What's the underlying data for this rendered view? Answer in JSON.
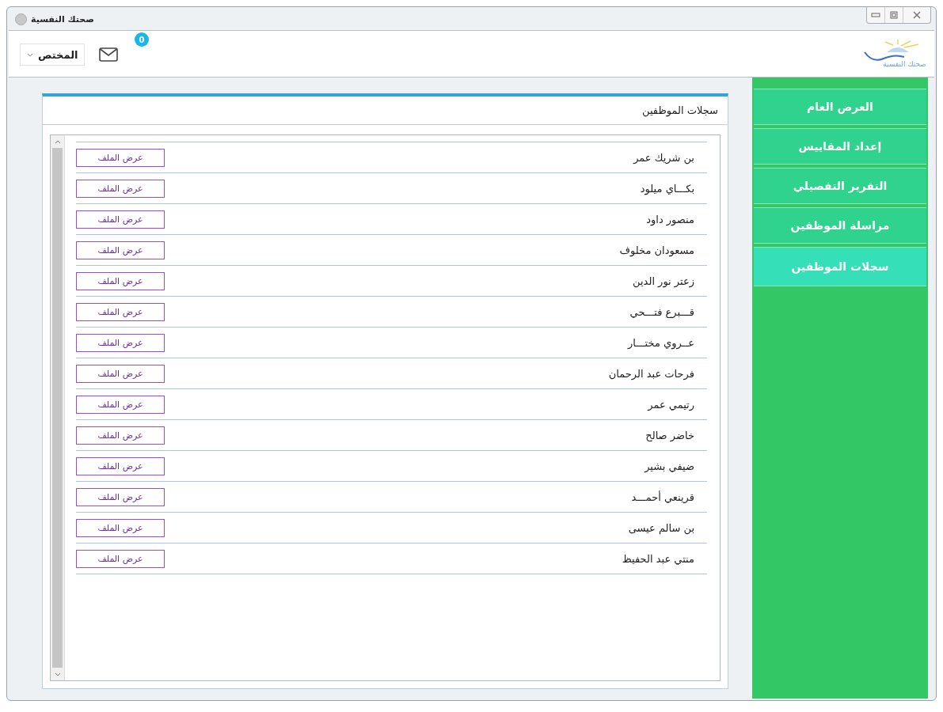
{
  "window": {
    "title": "صحتك النفسية"
  },
  "toolbar": {
    "user_menu": "المختص",
    "message_count": "0",
    "logo_text": "صحتك النفسية"
  },
  "sidebar": {
    "items": [
      {
        "label": "العرض العام",
        "selected": false
      },
      {
        "label": "إعداد المقاييس",
        "selected": false
      },
      {
        "label": "التقرير التفصيلي",
        "selected": false
      },
      {
        "label": "مراسلة الموظفين",
        "selected": false
      },
      {
        "label": "سجلات الموظفين",
        "selected": true
      }
    ]
  },
  "panel": {
    "title": "سجلات الموظفين",
    "rows": [
      {
        "name": "بن شريك عمر",
        "action": "عرض الملف"
      },
      {
        "name": "بكـــاي ميلود",
        "action": "عرض الملف"
      },
      {
        "name": "منصور داود",
        "action": "عرض الملف"
      },
      {
        "name": "مسعودان مخلوف",
        "action": "عرض الملف"
      },
      {
        "name": "زعتر نور الدين",
        "action": "عرض الملف"
      },
      {
        "name": "قـــبرع فتـــحي",
        "action": "عرض الملف"
      },
      {
        "name": "عــروي مختـــار",
        "action": "عرض الملف"
      },
      {
        "name": "فرحات عبد الرحمان",
        "action": "عرض الملف"
      },
      {
        "name": "رتيمي عمر",
        "action": "عرض الملف"
      },
      {
        "name": "خاضر صالح",
        "action": "عرض الملف"
      },
      {
        "name": "ضيفي بشير",
        "action": "عرض الملف"
      },
      {
        "name": "قرينعي أحمـــد",
        "action": "عرض الملف"
      },
      {
        "name": "بن سالم عيسى",
        "action": "عرض الملف"
      },
      {
        "name": "منتي عبد الحفيظ",
        "action": "عرض الملف"
      }
    ]
  }
}
